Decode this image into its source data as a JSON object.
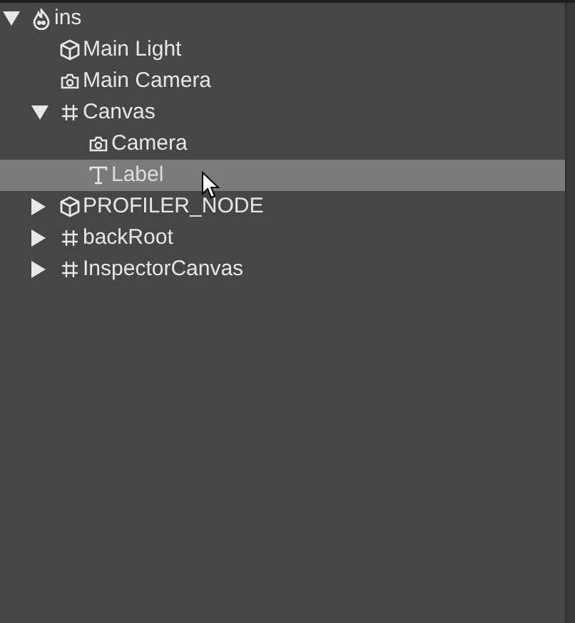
{
  "tree": [
    {
      "label": "ins",
      "kind": "scene",
      "expanded": true,
      "selected": false,
      "children": [
        {
          "label": "Main Light",
          "kind": "node",
          "selected": false
        },
        {
          "label": "Main Camera",
          "kind": "camera",
          "selected": false
        },
        {
          "label": "Canvas",
          "kind": "canvas",
          "expanded": true,
          "selected": false,
          "children": [
            {
              "label": "Camera",
              "kind": "camera",
              "selected": false
            },
            {
              "label": "Label",
              "kind": "text",
              "selected": true
            }
          ]
        },
        {
          "label": "PROFILER_NODE",
          "kind": "node",
          "expanded": false,
          "selected": false
        },
        {
          "label": "backRoot",
          "kind": "canvas",
          "expanded": false,
          "selected": false
        },
        {
          "label": "InspectorCanvas",
          "kind": "canvas",
          "expanded": false,
          "selected": false
        }
      ]
    }
  ]
}
